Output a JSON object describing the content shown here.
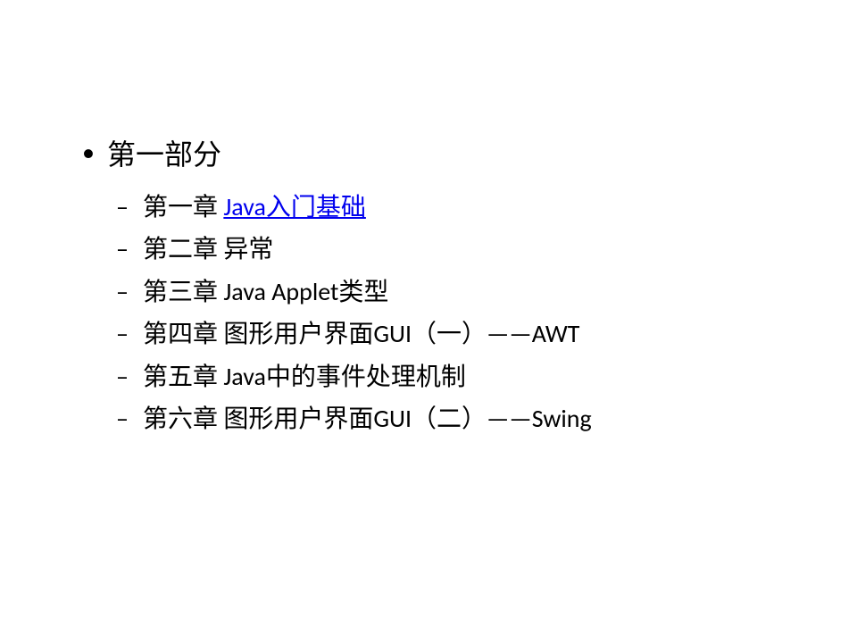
{
  "outline": {
    "part_title": "第一部分",
    "chapters": [
      {
        "prefix": "第一章 ",
        "title": "Java入门基础",
        "is_link": true
      },
      {
        "prefix": "第二章 ",
        "title": "异常",
        "is_link": false
      },
      {
        "prefix": "第三章 ",
        "title": "Java Applet类型",
        "is_link": false
      },
      {
        "prefix": "第四章 ",
        "title": "图形用户界面GUI（一）——AWT",
        "is_link": false
      },
      {
        "prefix": "第五章 ",
        "title": "Java中的事件处理机制",
        "is_link": false
      },
      {
        "prefix": "第六章 ",
        "title": "图形用户界面GUI（二）——Swing",
        "is_link": false
      }
    ]
  }
}
